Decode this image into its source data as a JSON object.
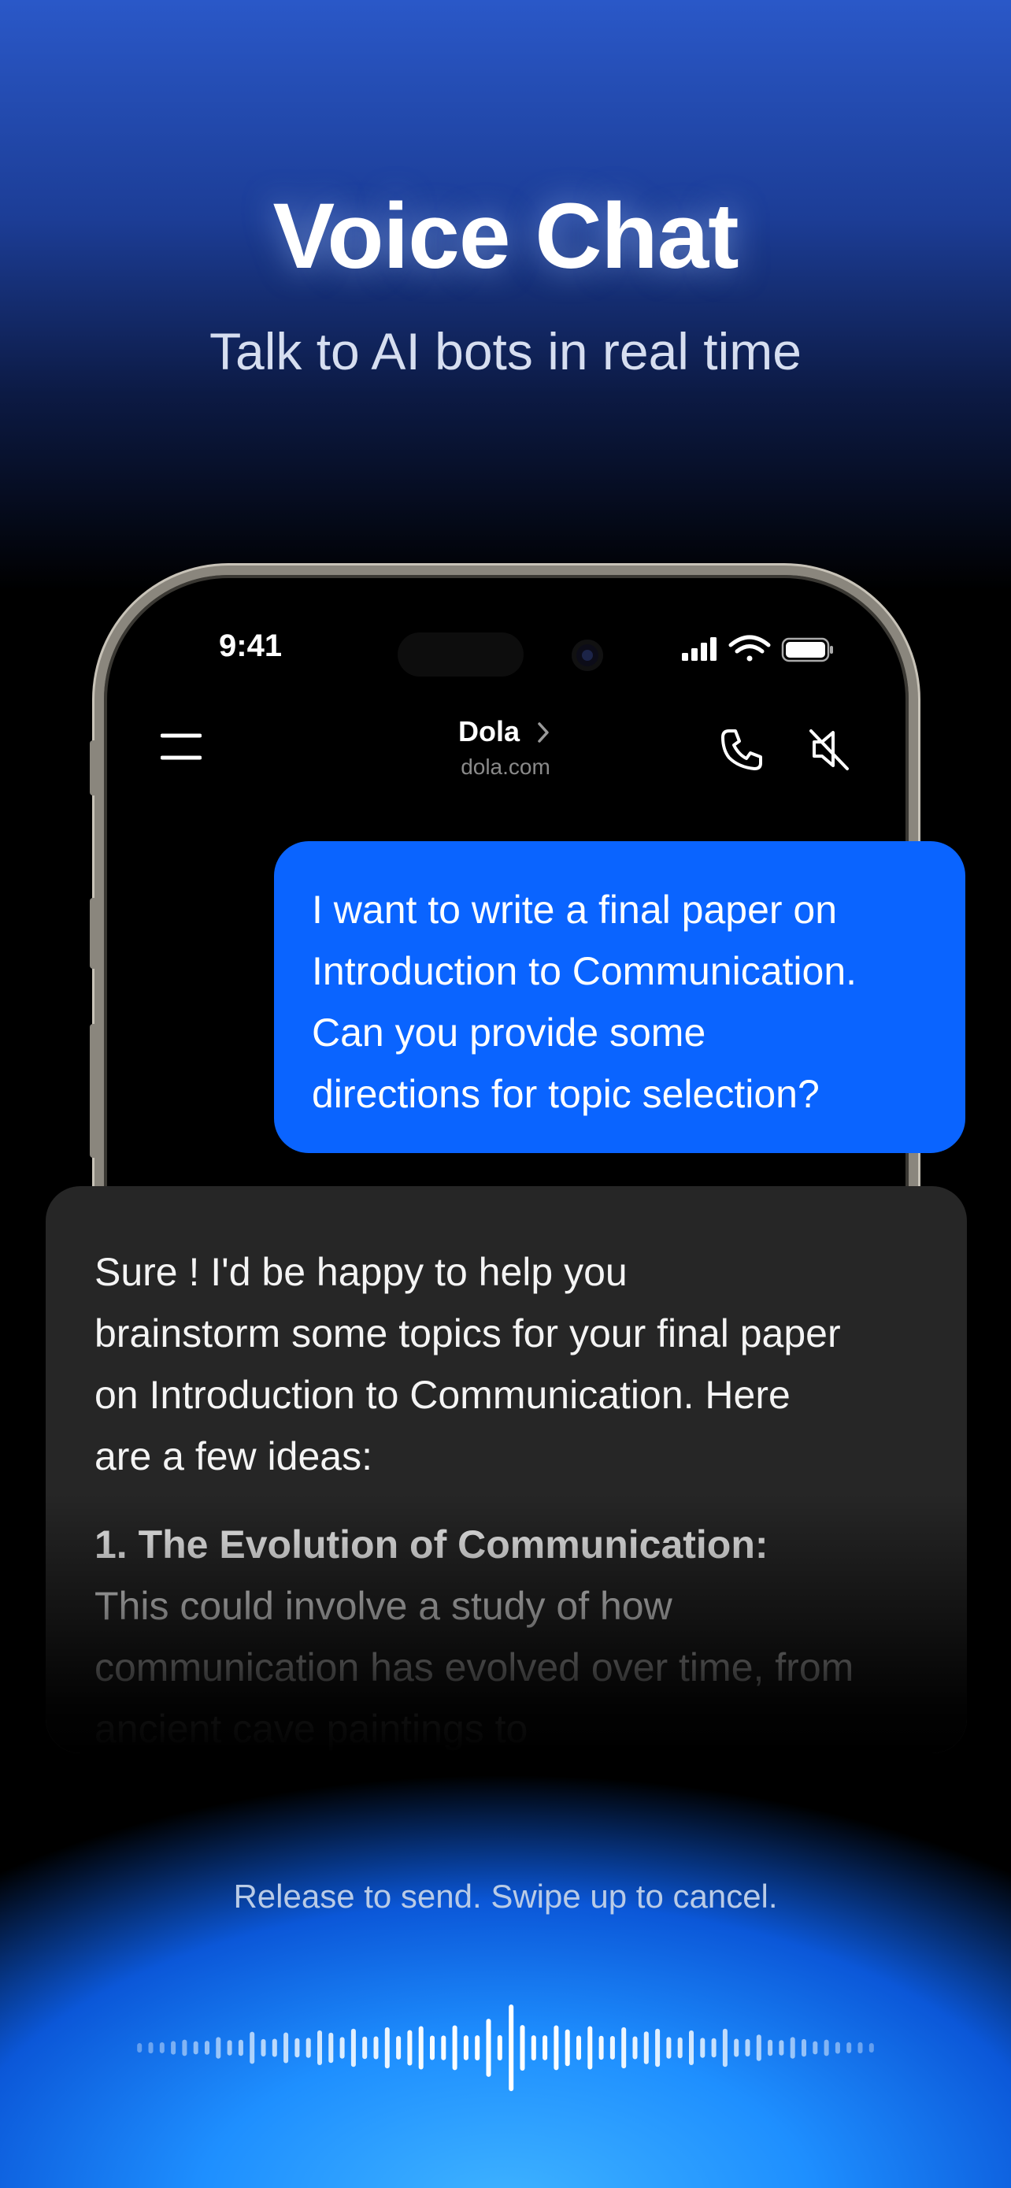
{
  "hero": {
    "title": "Voice Chat",
    "subtitle": "Talk to AI bots in real time"
  },
  "status_bar": {
    "time": "9:41",
    "icons": [
      "cellular-signal-icon",
      "wifi-icon",
      "battery-icon"
    ]
  },
  "nav": {
    "title": "Dola",
    "subtitle": "dola.com",
    "icons": [
      "menu-icon",
      "chevron-right-icon",
      "phone-icon",
      "speaker-mute-icon"
    ]
  },
  "messages": {
    "user": {
      "lines": [
        "I want to write a final paper on",
        "Introduction to Communication.",
        "Can you provide some",
        "directions for topic selection?"
      ]
    },
    "bot": {
      "intro_lines": [
        "Sure ! I'd be happy to help you",
        "brainstorm some topics for your final paper",
        "on Introduction to Communication. Here",
        "are a few ideas:"
      ],
      "point_title": "1. The Evolution of Communication:",
      "point_lines": [
        "This could involve a study of how",
        "communication has evolved over time, from",
        "ancient cave paintings to"
      ]
    }
  },
  "recording": {
    "hint": "Release to send. Swipe up to cancel."
  },
  "colors": {
    "user_bubble": "#0a64ff",
    "bot_card": "#262626",
    "accent_glow": "#3fb3ff"
  }
}
